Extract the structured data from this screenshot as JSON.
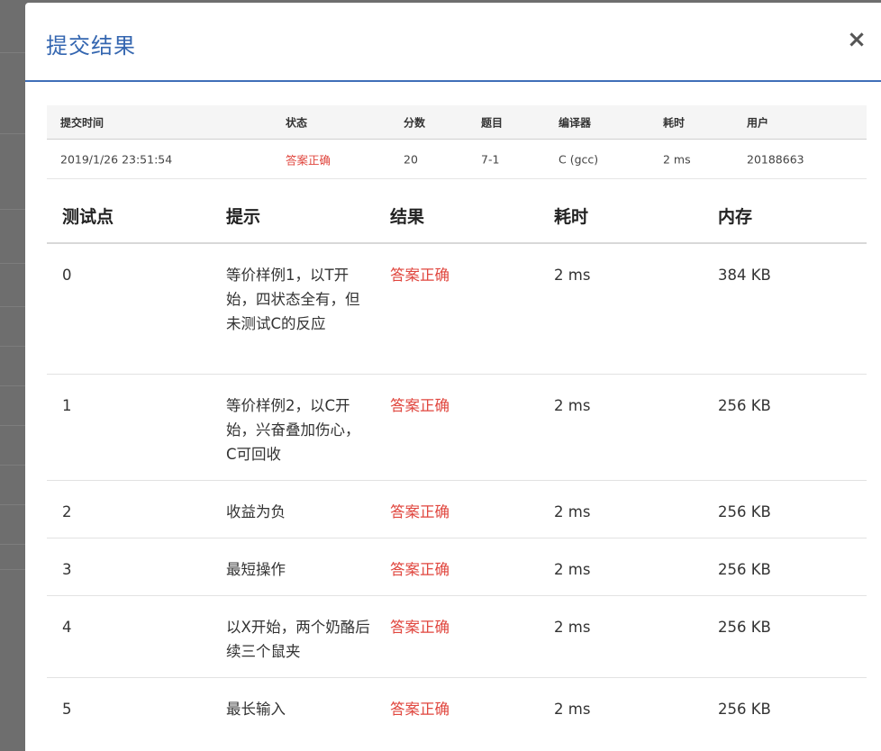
{
  "modal": {
    "title": "提交结果",
    "close_symbol": "×"
  },
  "summary": {
    "headers": [
      "提交时间",
      "状态",
      "分数",
      "题目",
      "编译器",
      "耗时",
      "用户"
    ],
    "row": {
      "time": "2019/1/26 23:51:54",
      "status": "答案正确",
      "score": "20",
      "problem": "7-1",
      "compiler": "C (gcc)",
      "duration": "2 ms",
      "user": "20188663"
    }
  },
  "cases": {
    "headers": [
      "测试点",
      "提示",
      "结果",
      "耗时",
      "内存"
    ],
    "rows": [
      {
        "id": "0",
        "hint": "等价样例1，以T开始，四状态全有，但未测试C的反应",
        "result": "答案正确",
        "time": "2 ms",
        "memory": "384 KB"
      },
      {
        "id": "1",
        "hint": "等价样例2，以C开始，兴奋叠加伤心，C可回收",
        "result": "答案正确",
        "time": "2 ms",
        "memory": "256 KB"
      },
      {
        "id": "2",
        "hint": "收益为负",
        "result": "答案正确",
        "time": "2 ms",
        "memory": "256 KB"
      },
      {
        "id": "3",
        "hint": "最短操作",
        "result": "答案正确",
        "time": "2 ms",
        "memory": "256 KB"
      },
      {
        "id": "4",
        "hint": "以X开始，两个奶酪后续三个鼠夹",
        "result": "答案正确",
        "time": "2 ms",
        "memory": "256 KB"
      },
      {
        "id": "5",
        "hint": "最长输入",
        "result": "答案正确",
        "time": "2 ms",
        "memory": "256 KB"
      }
    ]
  },
  "colors": {
    "accent": "#3466b0",
    "success_text": "#e0463e"
  }
}
